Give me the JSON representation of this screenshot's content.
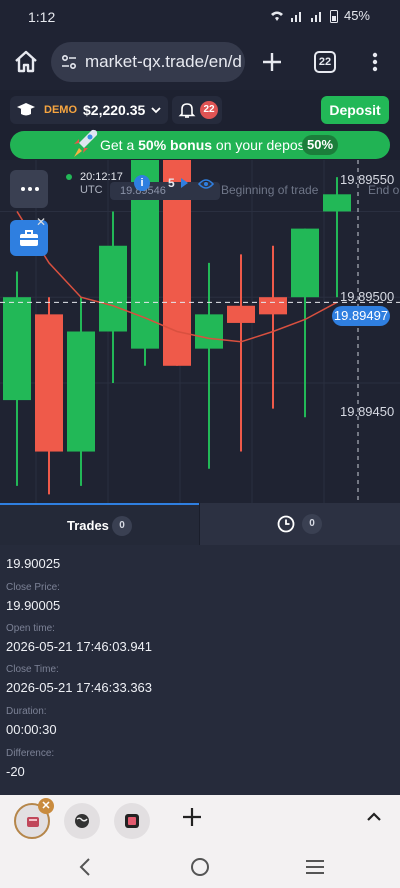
{
  "status_bar": {
    "time": "1:12",
    "battery": "45%"
  },
  "browser": {
    "url": "market-qx.trade/en/d",
    "tab_count": "22"
  },
  "account": {
    "mode": "DEMO",
    "balance": "$2,220.35",
    "notifications": "22",
    "deposit_label": "Deposit"
  },
  "banner": {
    "prefix": "Get a ",
    "bonus": "50% bonus",
    "suffix": " on your deposit!",
    "percent": "50%"
  },
  "chart": {
    "clock_time": "20:12:17",
    "clock_zone": "UTC",
    "pre_price": "19.89546",
    "info": "i",
    "duration_count": "5",
    "begin_label": "Beginning of trade",
    "end_label": "End o",
    "current_price": "19.89497",
    "price_ticks": [
      "19.89550",
      "19.89500",
      "19.89450"
    ],
    "colors": {
      "up": "#22b857",
      "down": "#ef5a4a",
      "ma": "#d9503f",
      "background": "#1f2332"
    }
  },
  "chart_data": {
    "type": "candlestick",
    "ylim": [
      19.8938,
      19.8958
    ],
    "y_ticks": [
      19.8955,
      19.895,
      19.8945
    ],
    "current_price": 19.89497,
    "candles": [
      {
        "open": 19.8944,
        "close": 19.895,
        "high": 19.89515,
        "low": 19.8939,
        "dir": "up"
      },
      {
        "open": 19.8949,
        "close": 19.8941,
        "high": 19.895,
        "low": 19.89385,
        "dir": "down"
      },
      {
        "open": 19.8941,
        "close": 19.8948,
        "high": 19.895,
        "low": 19.8939,
        "dir": "up"
      },
      {
        "open": 19.8948,
        "close": 19.8953,
        "high": 19.8955,
        "low": 19.8945,
        "dir": "up"
      },
      {
        "open": 19.8947,
        "close": 19.8959,
        "high": 19.8961,
        "low": 19.8946,
        "dir": "up"
      },
      {
        "open": 19.8959,
        "close": 19.8946,
        "high": 19.8962,
        "low": 19.8946,
        "dir": "down"
      },
      {
        "open": 19.8947,
        "close": 19.8949,
        "high": 19.8952,
        "low": 19.894,
        "dir": "up"
      },
      {
        "open": 19.89495,
        "close": 19.89485,
        "high": 19.89525,
        "low": 19.8941,
        "dir": "down"
      },
      {
        "open": 19.895,
        "close": 19.8949,
        "high": 19.8953,
        "low": 19.89435,
        "dir": "down"
      },
      {
        "open": 19.895,
        "close": 19.8954,
        "high": 19.8954,
        "low": 19.8943,
        "dir": "up"
      },
      {
        "open": 19.8955,
        "close": 19.8956,
        "high": 19.8957,
        "low": 19.895,
        "dir": "up"
      }
    ],
    "moving_average": [
      19.8955,
      19.8952,
      19.895,
      19.89495,
      19.89488,
      19.8948,
      19.89476,
      19.89474,
      19.8948,
      19.89487,
      19.89497
    ]
  },
  "tabs": {
    "trades_label": "Trades",
    "trades_count": "0",
    "history_count": "0"
  },
  "details": {
    "top_value": "19.90025",
    "close_price_label": "Close Price:",
    "close_price": "19.90005",
    "open_time_label": "Open time:",
    "open_time": "2026-05-21 17:46:03.941",
    "close_time_label": "Close Time:",
    "close_time": "2026-05-21 17:46:33.363",
    "duration_label": "Duration:",
    "duration": "00:00:30",
    "difference_label": "Difference:",
    "difference": "-20"
  }
}
